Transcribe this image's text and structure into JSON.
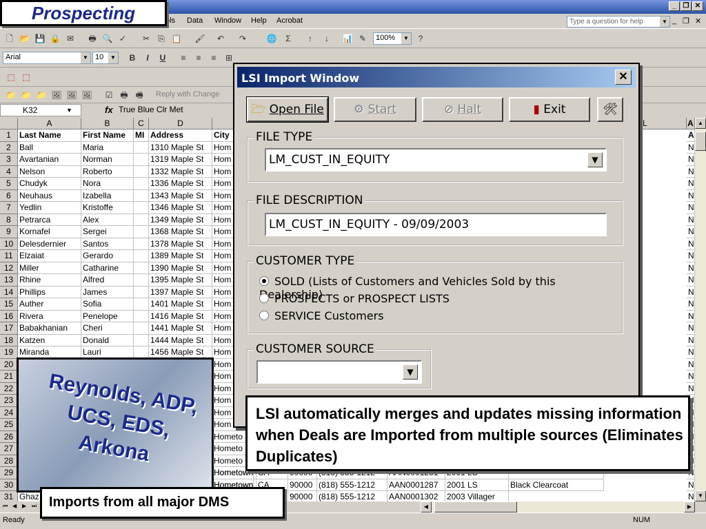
{
  "slide": {
    "title": "Prospecting",
    "callout_merge": "LSI automatically merges and updates missing information when Deals are Imported from multiple sources (Eliminates Duplicates)",
    "dms_logo_text": "Reynolds, ADP, UCS, EDS, Arkona",
    "callout_dms": "Imports from all major DMS"
  },
  "excel": {
    "menu": [
      "ols",
      "Data",
      "Window",
      "Help",
      "Acrobat"
    ],
    "question_placeholder": "Type a question for help",
    "font_name": "Arial",
    "font_size": "10",
    "zoom": "100%",
    "reply_with_changes": "Reply with Change",
    "name_box": "K32",
    "formula": "True Blue Clr Met",
    "status_left": "Ready",
    "status_right": "NUM",
    "columns": [
      "A",
      "B",
      "C",
      "D",
      "L",
      "A"
    ],
    "header_row": [
      "Last Name",
      "First Name",
      "MI",
      "Address",
      "City"
    ],
    "rows": [
      [
        "Ball",
        "Maria",
        "",
        "1310 Maple St",
        "Hom"
      ],
      [
        "Avartanian",
        "Norman",
        "",
        "1319 Maple St",
        "Hom"
      ],
      [
        "Nelson",
        "Roberto",
        "",
        "1332 Maple St",
        "Hom"
      ],
      [
        "Chudyk",
        "Nora",
        "",
        "1336 Maple St",
        "Hom"
      ],
      [
        "Neuhaus",
        "Izabella",
        "",
        "1343 Maple St",
        "Hom"
      ],
      [
        "Yedlin",
        "Kristoffe",
        "",
        "1346 Maple St",
        "Hom"
      ],
      [
        "Petrarca",
        "Alex",
        "",
        "1349 Maple St",
        "Hom"
      ],
      [
        "Kornafel",
        "Sergei",
        "",
        "1368 Maple St",
        "Hom"
      ],
      [
        "Delesdernier",
        "Santos",
        "",
        "1378 Maple St",
        "Hom"
      ],
      [
        "Elzaiat",
        "Gerardo",
        "",
        "1389 Maple St",
        "Hom"
      ],
      [
        "Miller",
        "Catharine",
        "",
        "1390 Maple St",
        "Hom"
      ],
      [
        "Rhine",
        "Alfred",
        "",
        "1395 Maple St",
        "Hom"
      ],
      [
        "Phillips",
        "James",
        "",
        "1397 Maple St",
        "Hom"
      ],
      [
        "Auther",
        "Sofia",
        "",
        "1401 Maple St",
        "Hom"
      ],
      [
        "Rivera",
        "Penelope",
        "",
        "1416 Maple St",
        "Hom"
      ],
      [
        "Babakhanian",
        "Cheri",
        "",
        "1441 Maple St",
        "Hom"
      ],
      [
        "Katzen",
        "Donald",
        "",
        "1444 Maple St",
        "Hom"
      ],
      [
        "Miranda",
        "Lauri",
        "",
        "1456 Maple St",
        "Hom"
      ]
    ],
    "row_numbers": [
      "1",
      "2",
      "3",
      "4",
      "5",
      "6",
      "7",
      "8",
      "9",
      "10",
      "11",
      "12",
      "13",
      "14",
      "15",
      "16",
      "17",
      "18",
      "19",
      "20",
      "21",
      "22",
      "23",
      "24",
      "25",
      "26",
      "27",
      "28",
      "29",
      "30",
      "31"
    ],
    "right_col_values": [
      "A",
      "N",
      "N",
      "N",
      "N",
      "N",
      "N",
      "N",
      "N",
      "N",
      "N",
      "N",
      "N",
      "N",
      "N",
      "N",
      "N",
      "N",
      "N",
      "N",
      "N",
      "N",
      "N",
      "N",
      "N",
      "N",
      "N",
      "N",
      "N",
      "N",
      "N"
    ],
    "lower_city": [
      "Hom",
      "Hom",
      "Hom",
      "Hom",
      "Hom",
      "Hom",
      "Hometo",
      "Hometo",
      "Hometo",
      "Hometown",
      "Hometown",
      "Hometown"
    ],
    "row29": [
      "Hometown",
      "CA",
      "90000",
      "(818) 555-1212",
      "AAN0001281",
      "2001 LS",
      ""
    ],
    "row30": [
      "Hometown",
      "CA",
      "90000",
      "(818) 555-1212",
      "AAN0001287",
      "2001 LS",
      "Black Clearcoat"
    ],
    "row31": [
      "Ghaz",
      "Hometown",
      "CA",
      "90000",
      "(818) 555-1212",
      "AAN0001302",
      "2003 Villager"
    ]
  },
  "dialog": {
    "title": "LSI Import Window",
    "buttons": {
      "open_file": "Open File",
      "start": "Start",
      "halt": "Halt",
      "exit": "Exit"
    },
    "file_type": {
      "legend": "FILE TYPE",
      "value": "LM_CUST_IN_EQUITY"
    },
    "file_description": {
      "legend": "FILE DESCRIPTION",
      "value": "LM_CUST_IN_EQUITY - 09/09/2003"
    },
    "customer_type": {
      "legend": "CUSTOMER TYPE",
      "options": [
        "SOLD (Lists of Customers and Vehicles Sold by this Dealership)",
        "PROSPECTS or PROSPECT LISTS",
        "SERVICE Customers"
      ],
      "selected": 0
    },
    "customer_source": {
      "legend": "CUSTOMER SOURCE",
      "value": ""
    }
  }
}
